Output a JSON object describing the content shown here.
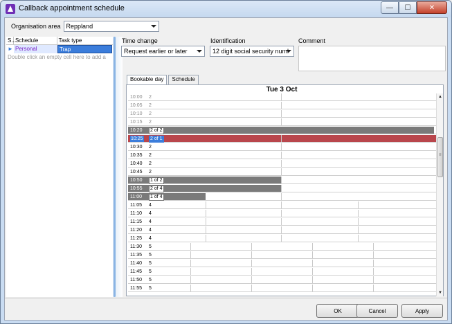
{
  "window": {
    "title": "Callback appointment schedule",
    "minimize_glyph": "—",
    "maximize_glyph": "☐",
    "close_glyph": "✕"
  },
  "organisation": {
    "label": "Organisation area",
    "value": "Reppland"
  },
  "left_table": {
    "headers": [
      "S...",
      "Schedule",
      "Task type"
    ],
    "row": {
      "status": "►",
      "schedule": "Personal",
      "task_type": "Trap"
    },
    "hint": "Double click an empty cell here to add a"
  },
  "time_change": {
    "label": "Time change",
    "value": "Request earlier or later"
  },
  "identification": {
    "label": "Identification",
    "value": "12 digit social security numl"
  },
  "comment": {
    "label": "Comment",
    "value": ""
  },
  "tabs": [
    {
      "label": "Bookable day",
      "active": true
    },
    {
      "label": "Schedule",
      "active": false
    }
  ],
  "schedule": {
    "date": "Tue 3 Oct",
    "slots": [
      {
        "time": "10:00",
        "count": "2",
        "state": "past"
      },
      {
        "time": "10:05",
        "count": "2",
        "state": "past"
      },
      {
        "time": "10:10",
        "count": "2",
        "state": "past"
      },
      {
        "time": "10:15",
        "count": "2",
        "state": "past"
      },
      {
        "time": "10:20",
        "count": "2 of 2",
        "state": "booked-full"
      },
      {
        "time": "10:25",
        "count": "2 of 1",
        "state": "selected"
      },
      {
        "time": "10:30",
        "count": "2",
        "state": "normal"
      },
      {
        "time": "10:35",
        "count": "2",
        "state": "normal"
      },
      {
        "time": "10:40",
        "count": "2",
        "state": "normal"
      },
      {
        "time": "10:45",
        "count": "2",
        "state": "normal"
      },
      {
        "time": "10:50",
        "count": "1 of 2",
        "state": "booked"
      },
      {
        "time": "10:55",
        "count": "2 of 4",
        "state": "booked"
      },
      {
        "time": "11:00",
        "count": "1 of 4",
        "state": "booked"
      },
      {
        "time": "11:05",
        "count": "4",
        "state": "normal"
      },
      {
        "time": "11:10",
        "count": "4",
        "state": "normal"
      },
      {
        "time": "11:15",
        "count": "4",
        "state": "normal"
      },
      {
        "time": "11:20",
        "count": "4",
        "state": "normal"
      },
      {
        "time": "11:25",
        "count": "4",
        "state": "normal"
      },
      {
        "time": "11:30",
        "count": "5",
        "state": "normal"
      },
      {
        "time": "11:35",
        "count": "5",
        "state": "normal"
      },
      {
        "time": "11:40",
        "count": "5",
        "state": "normal"
      },
      {
        "time": "11:45",
        "count": "5",
        "state": "normal"
      },
      {
        "time": "11:50",
        "count": "5",
        "state": "normal"
      },
      {
        "time": "11:55",
        "count": "5",
        "state": "normal"
      }
    ]
  },
  "buttons": {
    "ok": "OK",
    "cancel": "Cancel",
    "apply": "Apply"
  },
  "scrollbar": {
    "up_glyph": "▲",
    "down_glyph": "▼",
    "grip_glyph": "≡"
  },
  "colors": {
    "selected_row": "#b9464c",
    "booked_bar": "#7a7a7a",
    "task_highlight": "#3b7ddb",
    "schedule_text": "#7a22c7"
  }
}
